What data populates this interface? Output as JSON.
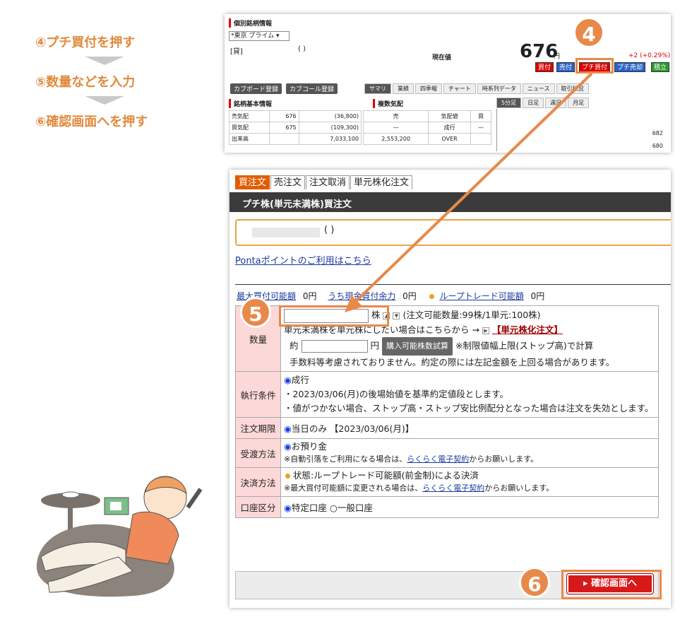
{
  "steps": [
    "④プチ買付を押す",
    "⑤数量などを入力",
    "⑥確認画面へを押す"
  ],
  "badges": {
    "b4": "4",
    "b5": "5",
    "b6": "6"
  },
  "top": {
    "title": "個別銘柄情報",
    "market_select": "*東京 プライム",
    "stock_prefix": "[貸]",
    "stock_paren": "(          )",
    "genzai_label": "現在値",
    "price": "676",
    "yen": "円",
    "change": "+2 (+0.29%)",
    "buttons": [
      "買付",
      "売付",
      "プチ買付",
      "プチ売却",
      "積立"
    ],
    "reg_buttons": [
      "カブボード登録",
      "カブコール登録"
    ],
    "tabs": [
      "サマリ",
      "業績",
      "四季報",
      "チャート",
      "時系列データ",
      "ニュース",
      "取引状況"
    ],
    "section_basic": "銘柄基本情報",
    "section_quote": "複数気配",
    "chart_tabs": [
      "5分足",
      "日足",
      "週足",
      "月足"
    ],
    "basic_rows": [
      {
        "label": "売気配",
        "v1": "676",
        "v2": "(36,800)"
      },
      {
        "label": "買気配",
        "v1": "675",
        "v2": "(109,300)"
      },
      {
        "label": "出来高",
        "v1": "",
        "v2": "7,033,100"
      }
    ],
    "quote_header": [
      "売",
      "気配値",
      "買"
    ],
    "quote_rows": [
      [
        "—",
        "成行",
        "—"
      ],
      [
        "2,553,200",
        "OVER",
        ""
      ]
    ],
    "chart_axis": [
      "682",
      "680"
    ]
  },
  "form": {
    "tabs": [
      "買注文",
      "売注文",
      "注文取消",
      "単元株化注文"
    ],
    "header": "プチ株(単元未満株)買注文",
    "stock_paren": "(          )",
    "ponta": "Pontaポイントのご利用はこちら",
    "kanou": {
      "l1": "最大買付可能額",
      "v1": "0円",
      "l2": "うち現金買付余力",
      "v2": "0円",
      "l3": "ループトレード可能額",
      "v3": "0円"
    },
    "qty": {
      "label": "数量",
      "unit": "株",
      "note": "(注文可能数量:99株/1単元:100株)",
      "line2": "単元未満株を単元株にしたい場合はこちらから →",
      "line2_link": "【単元株化注文】",
      "approx": "約",
      "yen": "円",
      "calc_btn": "購入可能株数試算",
      "calc_note": "※制限値幅上限(ストップ高)で計算",
      "fee_note": "手数料等考慮されておりません。約定の際には左記金額を上回る場合があります。"
    },
    "exec": {
      "label": "執行条件",
      "option": "成行",
      "line1": "・2023/03/06(月)の後場始値を基準約定値段とします。",
      "line2": "・値がつかない場合、ストップ高・ストップ安比例配分となった場合は注文を失効とします。"
    },
    "term": {
      "label": "注文期限",
      "option": "当日のみ",
      "date": "【2023/03/06(月)】"
    },
    "delivery": {
      "label": "受渡方法",
      "option": "お預り金",
      "note_pre": "※自動引落をご利用になる場合は、",
      "note_link": "らくらく電子契約",
      "note_post": "からお願いします。"
    },
    "settle": {
      "label": "決済方法",
      "status": "状態:ループトレード可能額(前金制)による決済",
      "note_pre": "※最大買付可能額に変更される場合は、",
      "note_link": "らくらく電子契約",
      "note_post": "からお願いします。"
    },
    "account": {
      "label": "口座区分",
      "opt1": "特定口座",
      "opt2": "一般口座"
    },
    "confirm": "確認画面へ"
  }
}
